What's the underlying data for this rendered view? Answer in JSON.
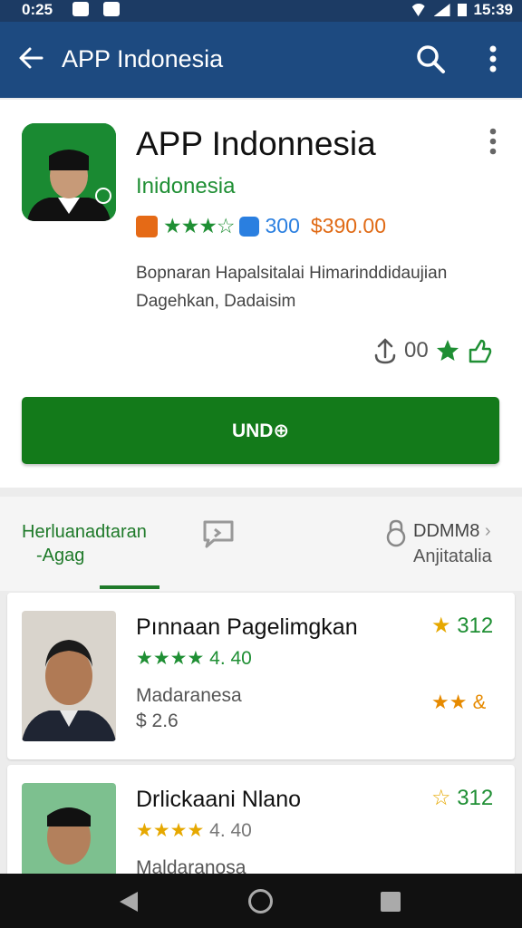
{
  "status_bar": {
    "time": "0:25",
    "clock": "15:39"
  },
  "toolbar": {
    "title": "APP Indonesia",
    "back_icon": "arrow-left-icon",
    "search_icon": "search-icon",
    "more_icon": "more-vert-icon"
  },
  "app": {
    "name": "APP Indonnesia",
    "developer": "Inidonesia",
    "stars": "★★★☆",
    "review_count": "300",
    "price": "$390.00",
    "description_line1": "Bopnaran Hapalsitalai Himarinddidaujian",
    "description_line2": "Dagehkan, Dadaisim",
    "stat_value": "00",
    "install_label": "UND⊕",
    "colors": {
      "accent_green": "#137a1a",
      "brand_blue": "#1d4a80",
      "price_orange": "#e06a15"
    }
  },
  "tabs": {
    "left_line1": "Herluanadtaran",
    "left_line2": "-Agag",
    "right_line1": "DDMM8",
    "right_line2": "Anjitatalia",
    "right_chevron": "›"
  },
  "items": [
    {
      "name": "Pınnaan Pagelimgkan",
      "stars": "★★★★",
      "rating_text": "4. 40",
      "sub1": "Madaranesa",
      "sub2": "$ 2.6",
      "right_top_value": "312",
      "right_bottom_stars": "★★",
      "right_bottom_symbol": "&"
    },
    {
      "name": "Drlickaani Nlano",
      "stars": "★★★★",
      "rating_text": "4. 40",
      "sub1": "Maldaranosa",
      "right_top_value": "312"
    }
  ]
}
